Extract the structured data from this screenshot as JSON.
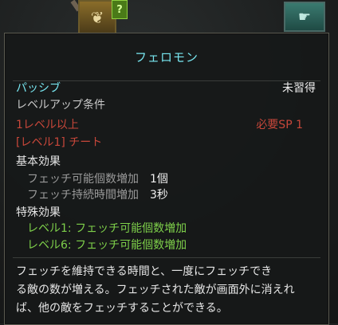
{
  "tooltip": {
    "title": "フェロモン",
    "type_label": "パッシブ",
    "status": "未習得",
    "requirement_header": "レベルアップ条件",
    "requirement_level": "1レベル以上",
    "requirement_sp": "必要SP 1",
    "requirement_skill": "[レベル1] チート",
    "basic_effects_header": "基本効果",
    "basic_effects": [
      {
        "label": "フェッチ可能個数増加",
        "value": "1個"
      },
      {
        "label": "フェッチ持続時間増加",
        "value": "3秒"
      }
    ],
    "special_effects_header": "特殊効果",
    "special_effects": [
      "レベル1: フェッチ可能個数増加",
      "レベル6: フェッチ可能個数増加"
    ],
    "description_lines": [
      "フェッチを維持できる時間と、一度にフェッチでき",
      "る敵の数が増える。フェッチされた敵が画面外に消えれ",
      "ば、他の敵をフェッチすることができる。"
    ]
  },
  "icons": {
    "skill_icon": "skill-icon",
    "help_badge": "question-badge-icon",
    "right_skill_icon": "claw-skill-icon"
  },
  "badge_text": "?",
  "colors": {
    "title": "#78e6f0",
    "requirement_unmet": "#c8473a",
    "special_effect": "#7ed04a",
    "panel_bg": "#161818"
  }
}
